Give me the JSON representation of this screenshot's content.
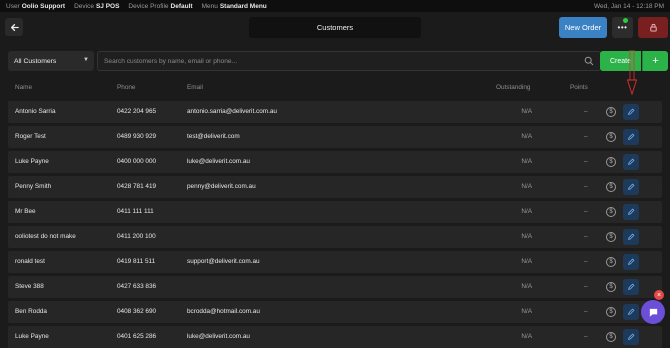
{
  "status_bar": {
    "user_label": "User",
    "user_value": "Oolio Support",
    "device_label": "Device",
    "device_value": "SJ POS",
    "profile_label": "Device Profile",
    "profile_value": "Default",
    "menu_label": "Menu",
    "menu_value": "Standard Menu",
    "datetime": "Wed, Jan 14 - 12:18 PM"
  },
  "header": {
    "title": "Customers",
    "new_order_label": "New Order",
    "more_label": "•••"
  },
  "toolbar": {
    "filter_selected": "All Customers",
    "search_placeholder": "Search customers by name, email or phone...",
    "create_label": "Create",
    "plus_label": "+"
  },
  "table": {
    "columns": {
      "name": "Name",
      "phone": "Phone",
      "email": "Email",
      "outstanding": "Outstanding",
      "points": "Points"
    },
    "rows": [
      {
        "name": "Antonio Sarria",
        "phone": "0422 204 965",
        "email": "antonio.sarria@deliverit.com.au",
        "outstanding": "N/A",
        "points": "–"
      },
      {
        "name": "Roger Test",
        "phone": "0489 930 929",
        "email": "test@deliverit.com",
        "outstanding": "N/A",
        "points": "–"
      },
      {
        "name": "Luke Payne",
        "phone": "0400 000 000",
        "email": "luke@deliverit.com.au",
        "outstanding": "N/A",
        "points": "–"
      },
      {
        "name": "Penny Smith",
        "phone": "0428 781 419",
        "email": "penny@deliverit.com.au",
        "outstanding": "N/A",
        "points": "–"
      },
      {
        "name": "Mr Bee",
        "phone": "0411 111 111",
        "email": "",
        "outstanding": "N/A",
        "points": "–"
      },
      {
        "name": "ooliotest do not make",
        "phone": "0411 200 100",
        "email": "",
        "outstanding": "N/A",
        "points": "–"
      },
      {
        "name": "ronald test",
        "phone": "0419 811 511",
        "email": "support@deliverit.com.au",
        "outstanding": "N/A",
        "points": "–"
      },
      {
        "name": "Steve 388",
        "phone": "0427 633 836",
        "email": "",
        "outstanding": "N/A",
        "points": "–"
      },
      {
        "name": "Ben Rodda",
        "phone": "0408 362 690",
        "email": "bcrodda@hotmail.com.au",
        "outstanding": "N/A",
        "points": "–"
      },
      {
        "name": "Luke Payne",
        "phone": "0401 625 286",
        "email": "luke@deliverit.com.au",
        "outstanding": "N/A",
        "points": "–"
      }
    ]
  },
  "icons": {
    "back": "arrow-left-icon",
    "lock": "lock-icon",
    "search": "search-icon",
    "dollar": "dollar-circle-icon",
    "edit": "pencil-icon",
    "chat": "chat-icon"
  },
  "colors": {
    "new_order": "#3b82c4",
    "create": "#2bb34a",
    "lock": "#7a1f1f",
    "edit": "#1e3a5a",
    "chat": "#6c4fd8",
    "annotation": "#e03030"
  }
}
